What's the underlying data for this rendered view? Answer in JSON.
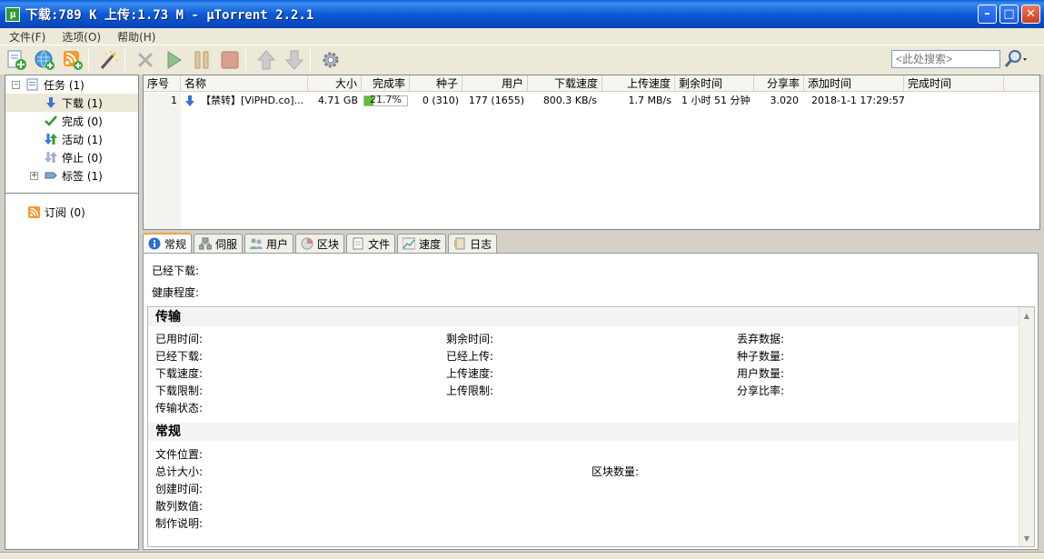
{
  "window": {
    "title": "下载:789 K 上传:1.73 M - µTorrent 2.2.1",
    "app_icon_glyph": "µ"
  },
  "menu": [
    "文件(F)",
    "选项(O)",
    "帮助(H)"
  ],
  "toolbar": {
    "search_placeholder": "<此处搜索>",
    "icons": [
      "add-torrent-icon",
      "add-url-icon",
      "rss-add-icon",
      "create-torrent-icon",
      "remove-icon",
      "start-icon",
      "pause-icon",
      "stop-icon",
      "move-up-icon",
      "move-down-icon",
      "preferences-icon"
    ]
  },
  "tree": {
    "tasks": "任务 (1)",
    "downloading": "下载 (1)",
    "completed": "完成 (0)",
    "active": "活动 (1)",
    "stopped": "停止 (0)",
    "labels": "标签 (1)",
    "feeds": "订阅 (0)"
  },
  "list": {
    "columns": [
      "序号",
      "名称",
      "大小",
      "完成率",
      "种子",
      "用户",
      "下载速度",
      "上传速度",
      "剩余时间",
      "分享率",
      "添加时间",
      "完成时间"
    ],
    "rows": [
      {
        "index": "1",
        "name": "【禁转】[ViPHD.co]...",
        "size": "4.71 GB",
        "progress_text": "21.7%",
        "progress": 0.217,
        "seeds": "0 (310)",
        "peers": "177 (1655)",
        "down_speed": "800.3 KB/s",
        "up_speed": "1.7 MB/s",
        "eta": "1 小时 51 分钟",
        "ratio": "3.020",
        "added": "2018-1-1 17:29:57",
        "completed": ""
      }
    ]
  },
  "tabs": [
    "常规",
    "伺服",
    "用户",
    "区块",
    "文件",
    "速度",
    "日志"
  ],
  "details": {
    "downloaded_label": "已经下载:",
    "availability_label": "健康程度:",
    "transfer_title": "传输",
    "transfer": {
      "time_elapsed": "已用时间:",
      "downloaded": "已经下载:",
      "download_speed": "下载速度:",
      "down_limit": "下载限制:",
      "status": "传输状态:",
      "remaining": "剩余时间:",
      "uploaded": "已经上传:",
      "upload_speed": "上传速度:",
      "up_limit": "上传限制:",
      "wasted": "丢弃数据:",
      "seeds": "种子数量:",
      "peers": "用户数量:",
      "share_ratio": "分享比率:"
    },
    "general_title": "常规",
    "general": {
      "save_as": "文件位置:",
      "total_size": "总计大小:",
      "pieces": "区块数量:",
      "created_on": "创建时间:",
      "hash": "散列数值:",
      "comment": "制作说明:"
    }
  }
}
